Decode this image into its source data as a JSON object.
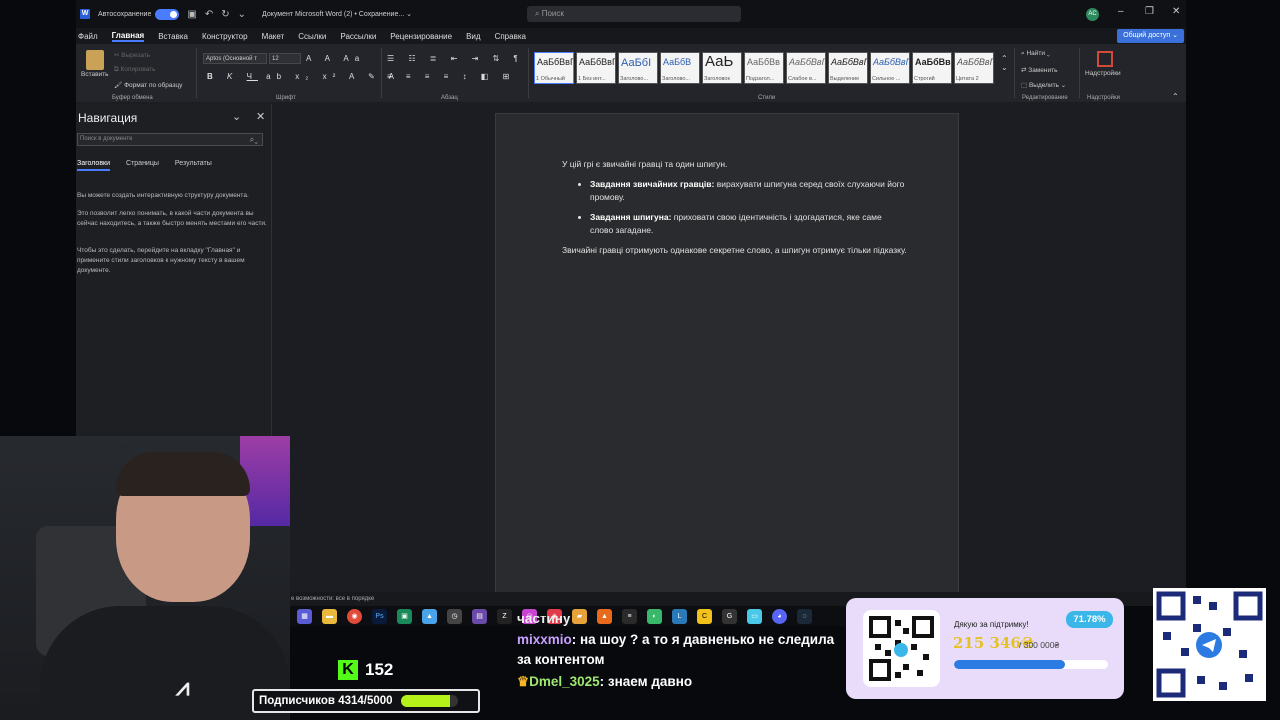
{
  "titlebar": {
    "autosave_label": "Автосохранение",
    "doc_title": "Документ Microsoft Word (2) • Сохранение... ⌄",
    "search_placeholder": "Поиск",
    "avatar": "AC"
  },
  "menu": {
    "items": [
      "Файл",
      "Главная",
      "Вставка",
      "Конструктор",
      "Макет",
      "Ссылки",
      "Рассылки",
      "Рецензирование",
      "Вид",
      "Справка"
    ],
    "share": "Общий доступ ⌄"
  },
  "ribbon": {
    "paste": "Вставить",
    "cut": "Вырезать",
    "copy": "Копировать",
    "format_painter": "Формат по образцу",
    "clipboard_group": "Буфер обмена",
    "font_name": "Aptos (Основной т",
    "font_size": "12",
    "font_group": "Шрифт",
    "paragraph_group": "Абзац",
    "styles_group": "Стили",
    "styles": [
      {
        "sample": "АаБбВвГ",
        "name": "1 Обычный"
      },
      {
        "sample": "АаБбВвГ",
        "name": "1 Без инт..."
      },
      {
        "sample": "АаБбI",
        "name": "Заголово..."
      },
      {
        "sample": "АаБбВ",
        "name": "Заголово..."
      },
      {
        "sample": "АаЬ",
        "name": "Заголовок"
      },
      {
        "sample": "АаБбВв",
        "name": "Подзагол..."
      },
      {
        "sample": "АаБбВвГ",
        "name": "Слабое в..."
      },
      {
        "sample": "АаБбВвГ",
        "name": "Выделение"
      },
      {
        "sample": "АаБбВвГ",
        "name": "Сильное ..."
      },
      {
        "sample": "АаБбВвГ",
        "name": "Строгий"
      },
      {
        "sample": "АаБбВвГ",
        "name": "Цитата 2"
      }
    ],
    "find": "Найти ⌄",
    "replace": "Заменить",
    "select": "Выделить ⌄",
    "editing_group": "Редактирование",
    "addins": "Надстройки",
    "addins_group": "Надстройки"
  },
  "nav": {
    "title": "Навигация",
    "search_placeholder": "Поиск в документе",
    "tabs": [
      "Заголовки",
      "Страницы",
      "Результаты"
    ],
    "para1": "Вы можете создать интерактивную структуру документа.",
    "para2": "Это позволит легко понимать, в какой части документа вы сейчас находитесь, а также быстро менять местами его части.",
    "para3": "Чтобы это сделать, перейдите на вкладку \"Главная\" и примените стили заголовков к нужному тексту в вашем документе."
  },
  "document": {
    "intro": "У цій грі є звичайні гравці та один шпигун.",
    "bullets": [
      {
        "bold": "Завдання звичайних гравців:",
        "text": " вирахувати шпигуна серед своїх слухаючи його промову."
      },
      {
        "bold": "Завдання шпигуна:",
        "text": " приховати свою ідентичність і здогадатися, яке саме слово загадане."
      }
    ],
    "outro": "Звичайні гравці отримують однакове секретне слово, а шпигун отримує  тільки підказку."
  },
  "status": {
    "text": "е возможности: все в порядке"
  },
  "stream": {
    "kick_count": "152",
    "subs_label": "Подписчиков 4314/5000",
    "subs_progress": 0.8628,
    "chat_partial": "частину",
    "chat": [
      {
        "user": "mixxmio",
        "message": ": на шоу ? а то я давненько не следила за контентом"
      },
      {
        "user": "Dmel_3025",
        "message": ": знаем давно"
      }
    ],
    "donate_title": "Дякую за підтримку!",
    "donate_percent": "71.78%",
    "donate_amount": "215 346₴",
    "donate_goal": "/ 300 000₴",
    "donate_progress": 0.7178
  },
  "colors": {
    "accent": "#4a7cff",
    "kick": "#53fc18",
    "subs_bar": "#b4f21a",
    "donate_bg": "#e9dcfa",
    "donate_bar": "#2b7be3"
  }
}
